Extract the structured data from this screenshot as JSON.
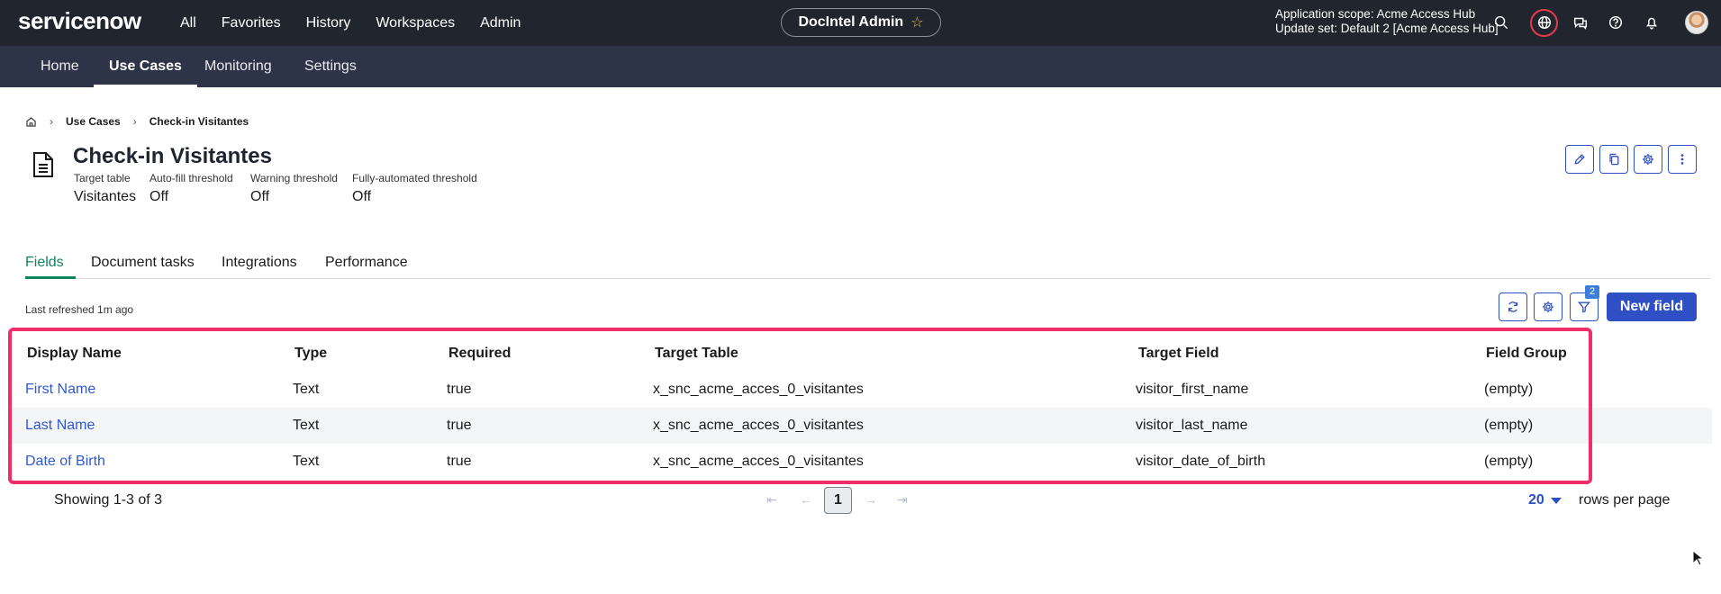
{
  "topbar": {
    "brand": "servicenow",
    "nav": [
      "All",
      "Favorites",
      "History",
      "Workspaces",
      "Admin"
    ],
    "app_name": "DocIntel Admin",
    "scope_line1": "Application scope: Acme Access Hub",
    "scope_line2": "Update set: Default 2 [Acme Access Hub]",
    "icons": [
      "search-icon",
      "globe-icon",
      "chat-icon",
      "help-icon",
      "bell-icon",
      "avatar"
    ]
  },
  "subnav": {
    "tabs": [
      "Home",
      "Use Cases",
      "Monitoring",
      "Settings"
    ],
    "active": "Use Cases"
  },
  "breadcrumb": {
    "items": [
      "Use Cases",
      "Check-in Visitantes"
    ]
  },
  "header": {
    "title": "Check-in Visitantes",
    "meta": [
      {
        "label": "Target table",
        "value": "Visitantes"
      },
      {
        "label": "Auto-fill threshold",
        "value": "Off"
      },
      {
        "label": "Warning threshold",
        "value": "Off"
      },
      {
        "label": "Fully-automated threshold",
        "value": "Off"
      }
    ],
    "actions": [
      "edit-icon",
      "copy-icon",
      "settings-icon",
      "more-icon"
    ]
  },
  "tabs": {
    "items": [
      "Fields",
      "Document tasks",
      "Integrations",
      "Performance"
    ],
    "active": "Fields"
  },
  "toolbar": {
    "last_refreshed": "Last refreshed 1m ago",
    "filter_count": "2",
    "new_button": "New field"
  },
  "table": {
    "columns": [
      "Display Name",
      "Type",
      "Required",
      "Target Table",
      "Target Field",
      "Field Group"
    ],
    "rows": [
      [
        "First Name",
        "Text",
        "true",
        "x_snc_acme_acces_0_visitantes",
        "visitor_first_name",
        "(empty)"
      ],
      [
        "Last Name",
        "Text",
        "true",
        "x_snc_acme_acces_0_visitantes",
        "visitor_last_name",
        "(empty)"
      ],
      [
        "Date of Birth",
        "Text",
        "true",
        "x_snc_acme_acces_0_visitantes",
        "visitor_date_of_birth",
        "(empty)"
      ]
    ]
  },
  "pagination": {
    "showing": "Showing 1-3 of 3",
    "current_page": "1",
    "rows_per_page_value": "20",
    "rows_per_page_label": "rows per page"
  },
  "colors": {
    "topbar": "#20252e",
    "subbar": "#2e3447",
    "accent": "#2f4fc4",
    "tab_active": "#11865c",
    "highlight": "#ef2f6a",
    "link": "#2f58d6"
  }
}
